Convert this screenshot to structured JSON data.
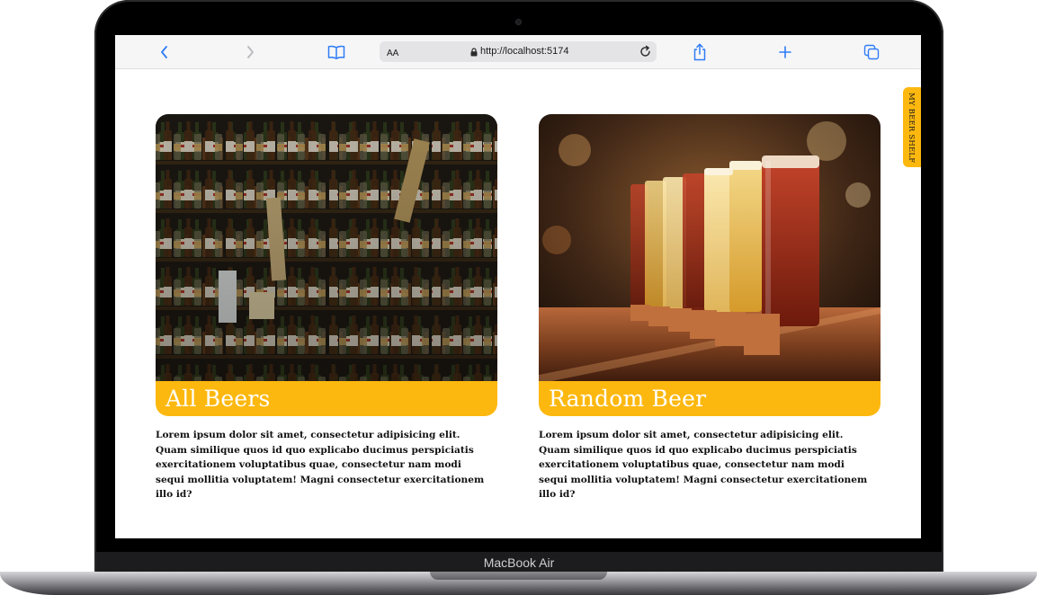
{
  "device": {
    "label": "MacBook Air"
  },
  "browser": {
    "text_size_button": "AA",
    "url": "http://localhost:5174",
    "icons": {
      "back": "chevron-left-icon",
      "forward": "chevron-right-icon",
      "bookmarks": "book-icon",
      "lock": "lock-icon",
      "reload": "reload-icon",
      "share": "share-icon",
      "new_tab": "plus-icon",
      "tabs": "tabs-overview-icon"
    },
    "accent_color": "#2f7cf6"
  },
  "page": {
    "accent_color": "#fdb80f",
    "side_tab": {
      "label": "MY BEER SHELF"
    },
    "cards": [
      {
        "title": "All Beers",
        "image": "beer-shelves-photo",
        "description": "Lorem ipsum dolor sit amet, consectetur adipisicing elit. Quam similique quos id quo explicabo ducimus perspiciatis exercitationem voluptatibus quae, consectetur nam modi sequi mollitia voluptatem! Magni consectetur exercitationem illo id?"
      },
      {
        "title": "Random Beer",
        "image": "beer-glasses-photo",
        "description": "Lorem ipsum dolor sit amet, consectetur adipisicing elit. Quam similique quos id quo explicabo ducimus perspiciatis exercitationem voluptatibus quae, consectetur nam modi sequi mollitia voluptatem! Magni consectetur exercitationem illo id?"
      }
    ]
  }
}
